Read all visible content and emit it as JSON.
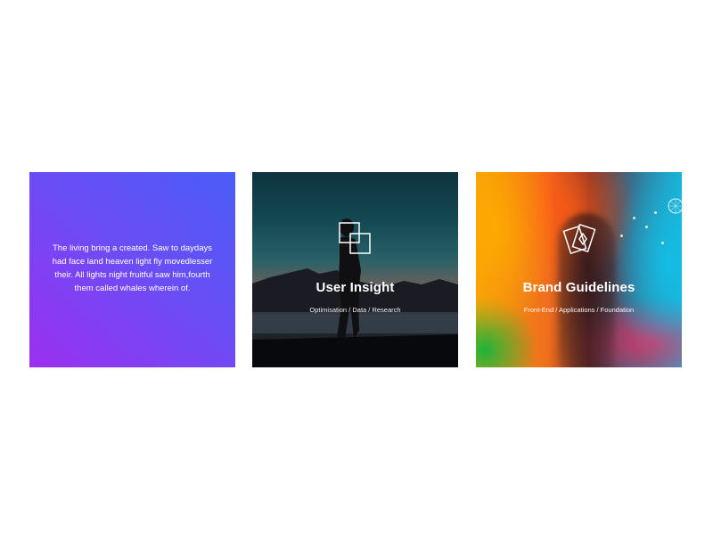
{
  "cards": [
    {
      "text": "The living bring a created. Saw to daydays had face land heaven light fly movedlesser their. All lights night fruitful saw him,fourth them called whales wherein of."
    },
    {
      "title": "User Insight",
      "subtitle": "Optimisation / Data / Research",
      "icon": "overlapping-squares-icon"
    },
    {
      "title": "Brand Guidelines",
      "subtitle": "Front-End / Applications / Foundation",
      "icon": "cards-icon"
    }
  ]
}
